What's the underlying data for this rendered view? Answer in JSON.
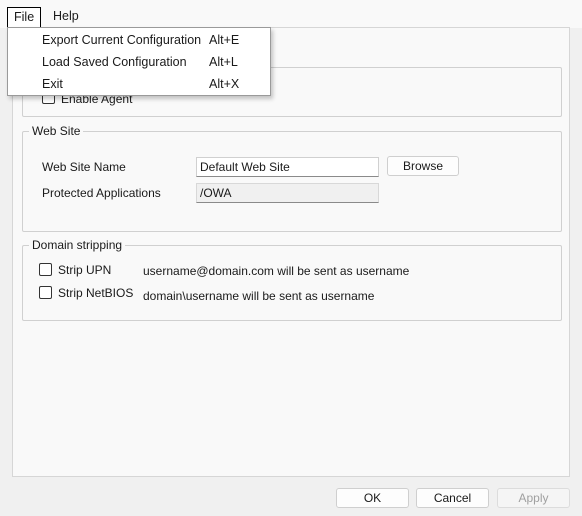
{
  "menubar": {
    "file": "File",
    "help": "Help"
  },
  "file_menu": {
    "items": [
      {
        "label": "Export Current Configuration",
        "shortcut": "Alt+E"
      },
      {
        "label": "Load Saved Configuration",
        "shortcut": "Alt+L"
      },
      {
        "label": "Exit",
        "shortcut": "Alt+X"
      }
    ]
  },
  "agent": {
    "enable_label": "Enable Agent",
    "enabled": false
  },
  "web_site": {
    "title": "Web Site",
    "name_label": "Web Site Name",
    "name_value": "Default Web Site",
    "browse_label": "Browse",
    "protected_label": "Protected Applications",
    "protected_value": "/OWA"
  },
  "domain_stripping": {
    "title": "Domain stripping",
    "upn_label": "Strip UPN",
    "upn_checked": false,
    "upn_desc": "username@domain.com will be sent as username",
    "netbios_label": "Strip NetBIOS",
    "netbios_checked": false,
    "netbios_desc": "domain\\username will be sent as username"
  },
  "footer": {
    "ok": "OK",
    "cancel": "Cancel",
    "apply": "Apply"
  }
}
